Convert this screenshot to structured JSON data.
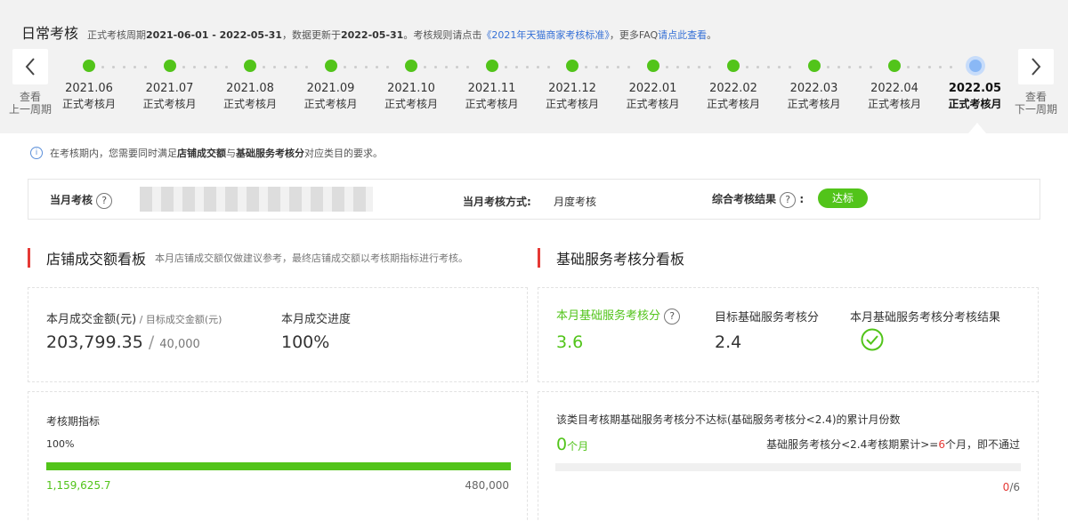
{
  "header": {
    "title": "日常考核",
    "period_prefix": "正式考核周期",
    "period": "2021-06-01 - 2022-05-31",
    "update_prefix": "，数据更新于",
    "update_date": "2022-05-31",
    "rule_prefix": "。考核规则请点击",
    "rule_link": "《2021年天猫商家考核标准》",
    "faq_prefix": "，更多FAQ",
    "faq_link": "请点此查看",
    "faq_suffix": "。"
  },
  "nav": {
    "prev_label_1": "查看",
    "prev_label_2": "上一周期",
    "next_label_1": "查看",
    "next_label_2": "下一周期",
    "prev_icon": "chevron-left-icon",
    "next_icon": "chevron-right-icon"
  },
  "timeline": [
    {
      "month": "2021.06",
      "label": "正式考核月"
    },
    {
      "month": "2021.07",
      "label": "正式考核月"
    },
    {
      "month": "2021.08",
      "label": "正式考核月"
    },
    {
      "month": "2021.09",
      "label": "正式考核月"
    },
    {
      "month": "2021.10",
      "label": "正式考核月"
    },
    {
      "month": "2021.11",
      "label": "正式考核月"
    },
    {
      "month": "2021.12",
      "label": "正式考核月"
    },
    {
      "month": "2022.01",
      "label": "正式考核月"
    },
    {
      "month": "2022.02",
      "label": "正式考核月"
    },
    {
      "month": "2022.03",
      "label": "正式考核月"
    },
    {
      "month": "2022.04",
      "label": "正式考核月"
    },
    {
      "month": "2022.05",
      "label": "正式考核月"
    }
  ],
  "notice": {
    "prefix": "在考核期内，您需要同时满足",
    "bold1": "店铺成交额",
    "mid": "与",
    "bold2": "基础服务考核分",
    "suffix": "对应类目的要求。"
  },
  "summary": {
    "assess_label": "当月考核",
    "method_label": "当月考核方式:",
    "method_value": "月度考核",
    "result_label": "综合考核结果",
    "result_colon": ":",
    "result_badge": "达标",
    "help_mark": "?"
  },
  "gmv": {
    "title": "店铺成交额看板",
    "note": "本月店铺成交额仅做建议参考，最终店铺成交额以考核期指标进行考核。",
    "amount_label": "本月成交金额(元)",
    "target_label": " / 目标成交金额(元)",
    "amount_value": "203,799.35",
    "slash": " / ",
    "target_value": "40,000",
    "progress_label": "本月成交进度",
    "progress_value": "100%",
    "period_label": "考核期指标",
    "period_pct": "100%",
    "period_progress": 1.0,
    "period_done": "1,159,625.7",
    "period_target": "480,000"
  },
  "service": {
    "title": "基础服务考核分看板",
    "score_label": "本月基础服务考核分",
    "score_value": "3.6",
    "target_label": "目标基础服务考核分",
    "target_value": "2.4",
    "result_label": "本月基础服务考核分考核结果",
    "fail_label": "该类目考核期基础服务考核分不达标(基础服务考核分<2.4)的累计月份数",
    "fail_value": "0",
    "fail_unit": "个月",
    "rule_prefix": "基础服务考核分<2.4考核期累计>=",
    "rule_num": "6",
    "rule_suffix": "个月，即不通过",
    "count_done": "0",
    "count_total": "/6",
    "count_progress": 0
  },
  "colors": {
    "green": "#52c41a",
    "red": "#e53935",
    "link": "#3570d6"
  }
}
